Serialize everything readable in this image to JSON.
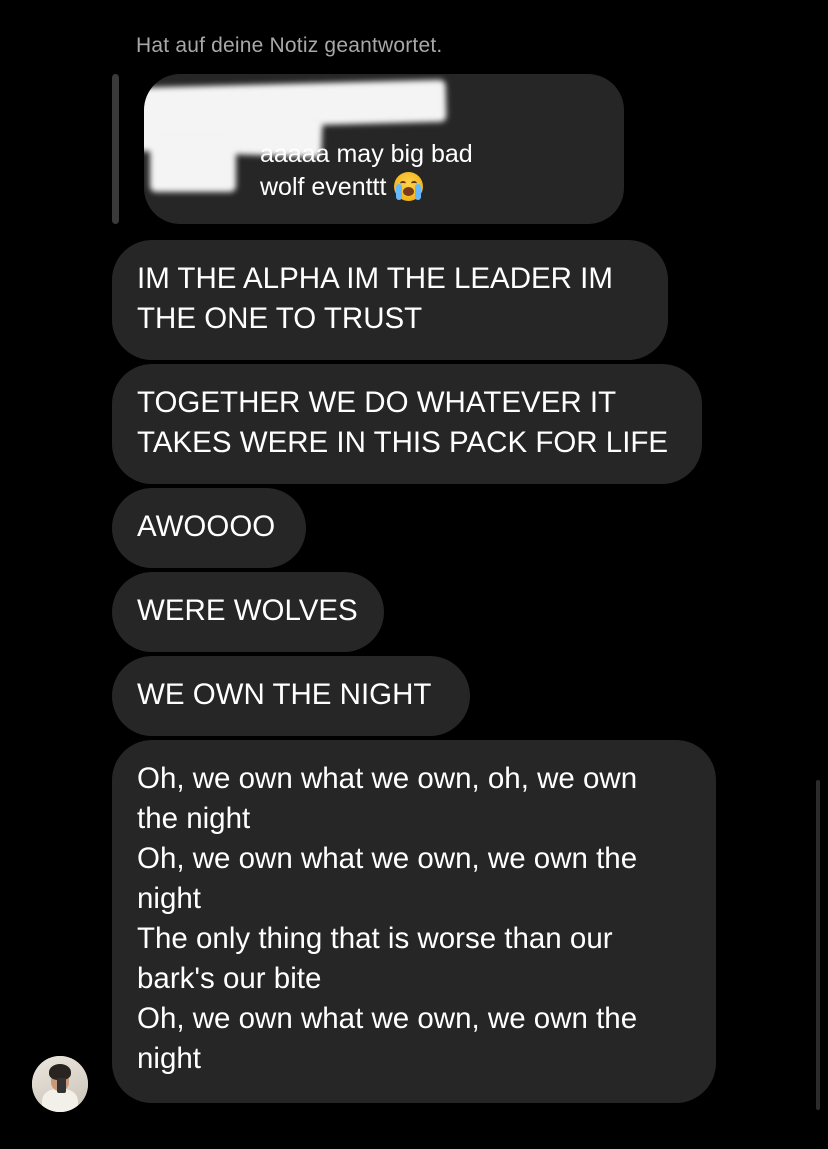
{
  "reply": {
    "header": "Hat auf deine Notiz geantwortet.",
    "note_lines": [
      "aaaaa may big bad",
      "wolf eventtt"
    ],
    "note_emoji": "loudly-crying-face-icon"
  },
  "messages": [
    {
      "lines": [
        "IM THE ALPHA IM THE LEADER IM",
        "THE ONE TO TRUST"
      ]
    },
    {
      "lines": [
        "TOGETHER WE DO WHATEVER IT",
        "TAKES WERE IN THIS PACK FOR LIFE"
      ]
    },
    {
      "lines": [
        "AWOOOO"
      ]
    },
    {
      "lines": [
        "WERE WOLVES"
      ]
    },
    {
      "lines": [
        "WE OWN THE NIGHT"
      ]
    },
    {
      "lines": [
        "Oh, we own what we own, oh, we own",
        "the night",
        "Oh, we own what we own, we own the",
        "night",
        "The only thing that is worse than our",
        "bark's our bite",
        "Oh, we own what we own, we own the",
        "night"
      ]
    }
  ],
  "colors": {
    "background": "#000000",
    "bubble": "#262626",
    "text": "#ffffff",
    "meta_text": "#a8a8a8"
  },
  "sender_avatar": "sender-avatar"
}
